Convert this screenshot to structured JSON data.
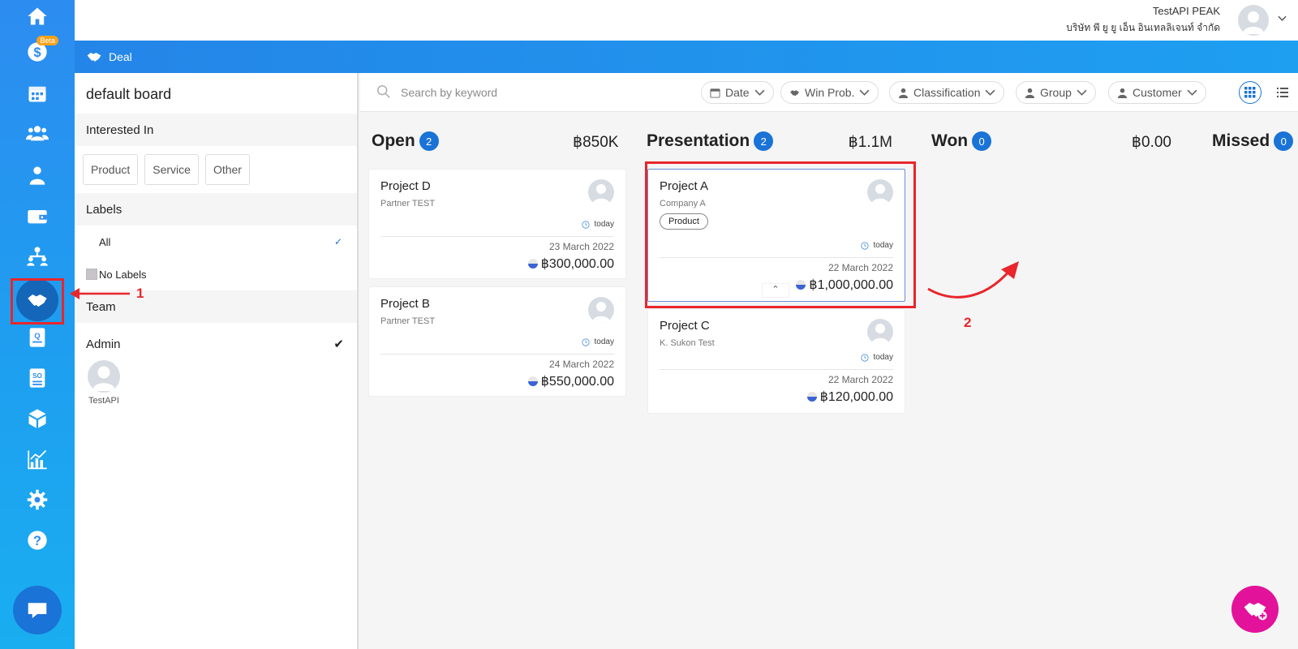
{
  "header": {
    "user_name": "TestAPI PEAK",
    "company_name": "บริษัท พี ยู ยู เอ็น อินเทลลิเจนท์ จำกัด"
  },
  "nav": {
    "beta_badge": "Beta",
    "active_item": "deal"
  },
  "page": {
    "title": "Deal"
  },
  "sidebar": {
    "board_name": "default board",
    "interested_in": {
      "heading": "Interested In",
      "options": [
        "Product",
        "Service",
        "Other"
      ]
    },
    "labels": {
      "heading": "Labels",
      "all_label": "All",
      "no_labels": "No Labels"
    },
    "team": {
      "heading": "Team",
      "admin_label": "Admin",
      "member_name": "TestAPI"
    }
  },
  "toolbar": {
    "search_placeholder": "Search by keyword",
    "filters": [
      "Date",
      "Win Prob.",
      "Classification",
      "Group",
      "Customer"
    ]
  },
  "columns": [
    {
      "name": "Open",
      "count": "2",
      "amount": "฿850K",
      "cards": [
        {
          "title": "Project D",
          "company": "Partner TEST",
          "time": "today",
          "date": "23 March 2022",
          "value": "฿300,000.00"
        },
        {
          "title": "Project B",
          "company": "Partner TEST",
          "time": "today",
          "date": "24 March 2022",
          "value": "฿550,000.00"
        }
      ]
    },
    {
      "name": "Presentation",
      "count": "2",
      "amount": "฿1.1M",
      "cards": [
        {
          "title": "Project A",
          "company": "Company A",
          "tag": "Product",
          "time": "today",
          "date": "22 March 2022",
          "value": "฿1,000,000.00"
        },
        {
          "title": "Project C",
          "company": "K. Sukon Test",
          "time": "today",
          "date": "22 March 2022",
          "value": "฿120,000.00"
        }
      ]
    },
    {
      "name": "Won",
      "count": "0",
      "amount": "฿0.00",
      "cards": []
    },
    {
      "name": "Missed",
      "count": "0",
      "cards": []
    }
  ],
  "annotations": {
    "step1": "1",
    "step2": "2",
    "color": "#e8262b"
  },
  "colors": {
    "primary": "#1a73d6",
    "fab": "#e3129b"
  }
}
